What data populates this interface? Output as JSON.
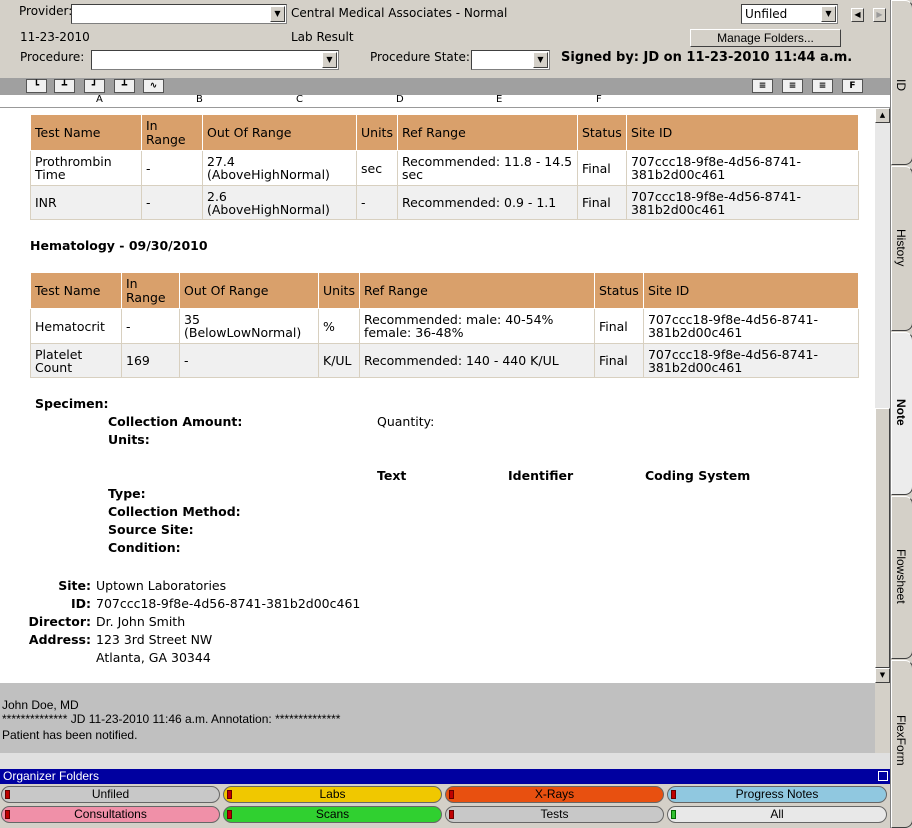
{
  "header": {
    "provider_label": "Provider:",
    "provider_value": "",
    "practice": "Central Medical Associates - Normal",
    "date": "11-23-2010",
    "doc_type": "Lab Result",
    "procedure_label": "Procedure:",
    "procedure_value": "",
    "procedure_state_label": "Procedure State:",
    "procedure_state_value": "",
    "signed_by": "Signed by: JD on 11-23-2010   11:44 a.m.",
    "folder_value": "Unfiled",
    "manage_folders": "Manage Folders..."
  },
  "ruler": {
    "marks": [
      "A",
      "B",
      "C",
      "D",
      "E",
      "F"
    ]
  },
  "coag_table": {
    "headers": [
      "Test Name",
      "In Range",
      "Out Of Range",
      "Units",
      "Ref Range",
      "Status",
      "Site ID"
    ],
    "rows": [
      [
        "Prothrombin Time",
        "-",
        "27.4 (AboveHighNormal)",
        "sec",
        "Recommended: 11.8 - 14.5 sec",
        "Final",
        "707ccc18-9f8e-4d56-8741-381b2d00c461"
      ],
      [
        "INR",
        "-",
        "2.6 (AboveHighNormal)",
        "-",
        "Recommended: 0.9 - 1.1",
        "Final",
        "707ccc18-9f8e-4d56-8741-381b2d00c461"
      ]
    ]
  },
  "hematology_title": "Hematology - 09/30/2010",
  "hema_table": {
    "headers": [
      "Test Name",
      "In Range",
      "Out Of Range",
      "Units",
      "Ref Range",
      "Status",
      "Site ID"
    ],
    "rows": [
      [
        "Hematocrit",
        "-",
        "35 (BelowLowNormal)",
        "%",
        "Recommended: male: 40-54% female: 36-48%",
        "Final",
        "707ccc18-9f8e-4d56-8741-381b2d00c461"
      ],
      [
        "Platelet Count",
        "169",
        "-",
        "K/UL",
        "Recommended: 140 - 440 K/UL",
        "Final",
        "707ccc18-9f8e-4d56-8741-381b2d00c461"
      ]
    ]
  },
  "specimen": {
    "title": "Specimen:",
    "collection_amount": "Collection Amount:",
    "quantity": "Quantity:",
    "units": "Units:",
    "col_text": "Text",
    "col_identifier": "Identifier",
    "col_coding": "Coding System",
    "type": "Type:",
    "collection_method": "Collection Method:",
    "source_site": "Source Site:",
    "condition": "Condition:"
  },
  "site": {
    "site_label": "Site:",
    "site_value": "Uptown Laboratories",
    "id_label": "ID:",
    "id_value": "707ccc18-9f8e-4d56-8741-381b2d00c461",
    "director_label": "Director:",
    "director_value": "Dr. John Smith",
    "address_label": "Address:",
    "address_line1": "123 3rd Street NW",
    "address_line2": "Atlanta, GA 30344"
  },
  "annotation": {
    "line1": "John Doe, MD",
    "line2": "************** JD 11-23-2010  11:46 a.m. Annotation: **************",
    "line3": "Patient has been notified."
  },
  "organizer": {
    "title": "Organizer Folders",
    "folders": [
      {
        "label": "Unfiled",
        "color": "#c8c8c8"
      },
      {
        "label": "Labs",
        "color": "#f0c800"
      },
      {
        "label": "X-Rays",
        "color": "#e85010"
      },
      {
        "label": "Progress Notes",
        "color": "#90c8e0"
      },
      {
        "label": "Consultations",
        "color": "#f090a8"
      },
      {
        "label": "Scans",
        "color": "#30d030"
      },
      {
        "label": "Tests",
        "color": "#c8c8c8"
      },
      {
        "label": "All",
        "color": "#e8e8e8"
      }
    ]
  },
  "side_tabs": [
    "ID",
    "History",
    "Note",
    "Flowsheet",
    "FlexForm"
  ]
}
